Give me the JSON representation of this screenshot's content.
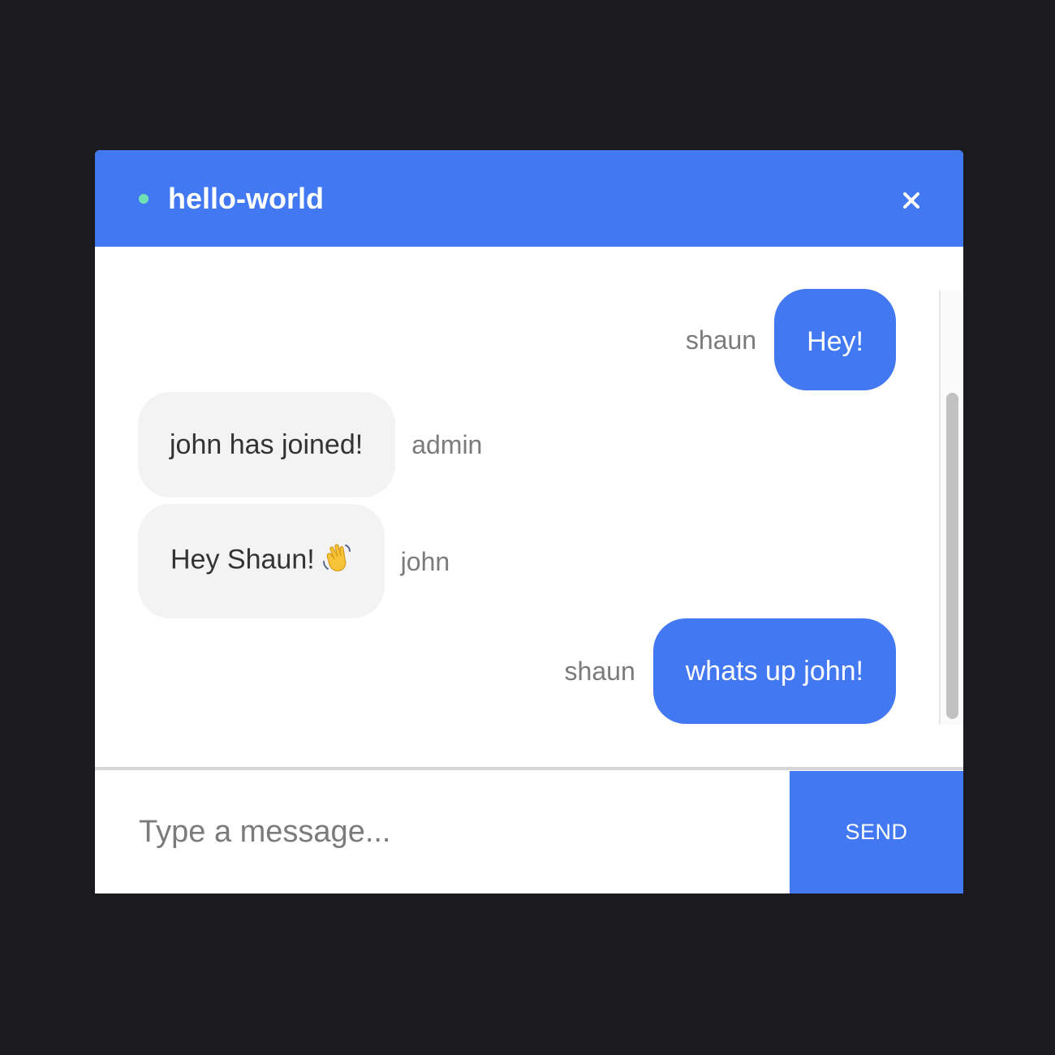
{
  "header": {
    "room_name": "hello-world",
    "status": "online",
    "close_icon": "close-icon"
  },
  "messages": [
    {
      "author": "shaun",
      "text": "Hey!",
      "own": true
    },
    {
      "author": "admin",
      "text": "john has joined!",
      "own": false
    },
    {
      "author": "john",
      "text": "Hey Shaun!",
      "emoji": "waving-hand-icon",
      "own": false
    },
    {
      "author": "shaun",
      "text": "whats up john!",
      "own": true
    }
  ],
  "composer": {
    "placeholder": "Type a message...",
    "send_label": "SEND"
  },
  "colors": {
    "accent": "#4278f2",
    "status_online": "#6fe1b3",
    "background": "#1b1b1f",
    "bubble_other": "#f3f3f3"
  }
}
